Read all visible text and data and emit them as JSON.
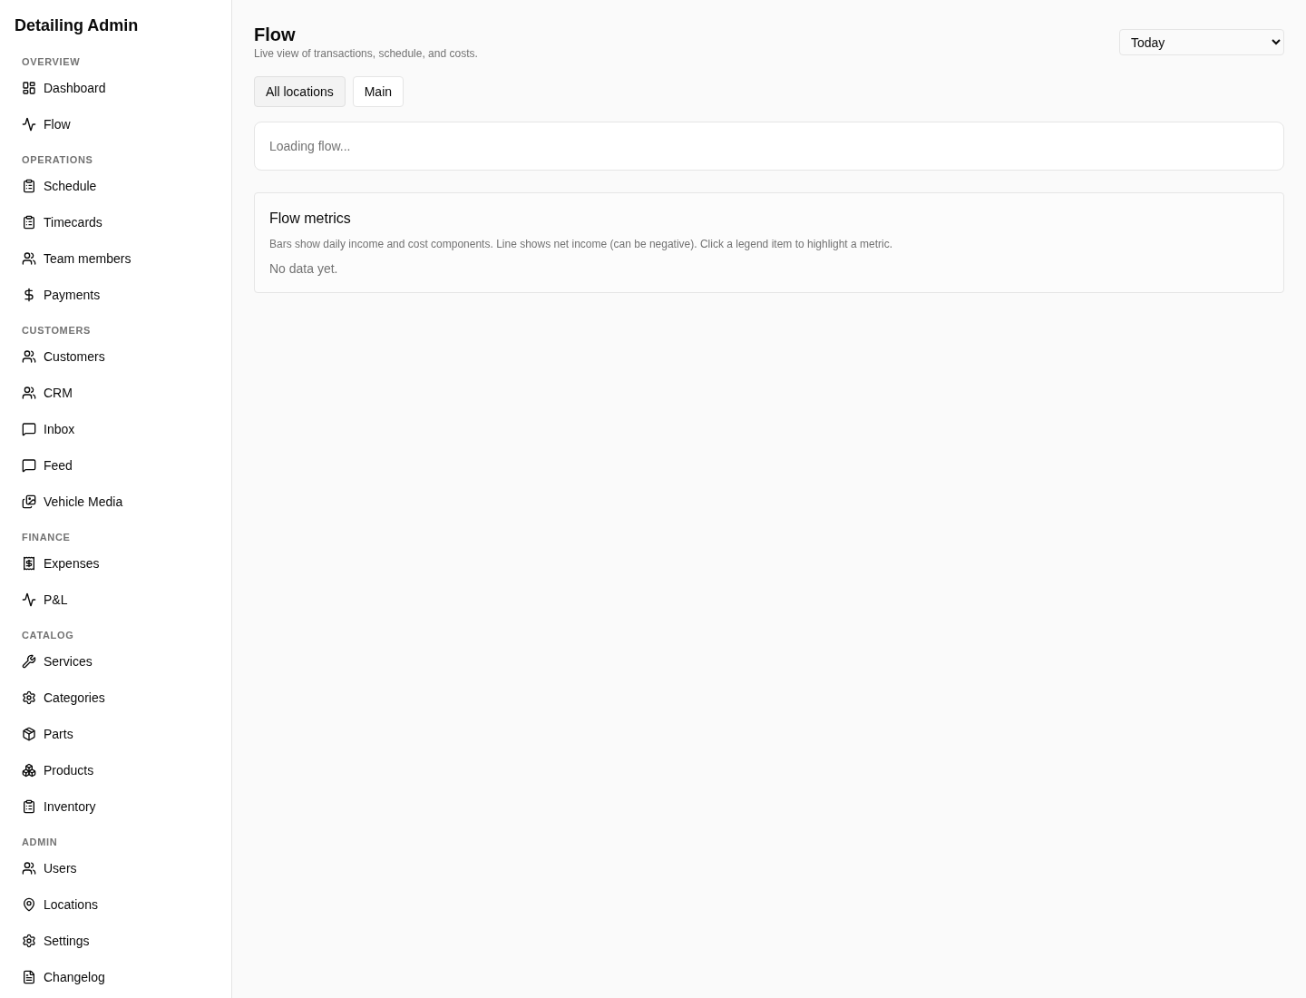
{
  "sidebar": {
    "title": "Detailing Admin",
    "sections": [
      {
        "label": "OVERVIEW",
        "items": [
          {
            "label": "Dashboard"
          },
          {
            "label": "Flow"
          }
        ]
      },
      {
        "label": "OPERATIONS",
        "items": [
          {
            "label": "Schedule"
          },
          {
            "label": "Timecards"
          },
          {
            "label": "Team members"
          },
          {
            "label": "Payments"
          }
        ]
      },
      {
        "label": "CUSTOMERS",
        "items": [
          {
            "label": "Customers"
          },
          {
            "label": "CRM"
          },
          {
            "label": "Inbox"
          },
          {
            "label": "Feed"
          },
          {
            "label": "Vehicle Media"
          }
        ]
      },
      {
        "label": "FINANCE",
        "items": [
          {
            "label": "Expenses"
          },
          {
            "label": "P&L"
          }
        ]
      },
      {
        "label": "CATALOG",
        "items": [
          {
            "label": "Services"
          },
          {
            "label": "Categories"
          },
          {
            "label": "Parts"
          },
          {
            "label": "Products"
          },
          {
            "label": "Inventory"
          }
        ]
      },
      {
        "label": "ADMIN",
        "items": [
          {
            "label": "Users"
          },
          {
            "label": "Locations"
          },
          {
            "label": "Settings"
          },
          {
            "label": "Changelog"
          }
        ]
      }
    ]
  },
  "header": {
    "title": "Flow",
    "subtitle": "Live view of transactions, schedule, and costs.",
    "range_select": {
      "value": "Today"
    }
  },
  "location_tabs": [
    {
      "label": "All locations",
      "selected": true
    },
    {
      "label": "Main",
      "selected": false
    }
  ],
  "status_card": {
    "text": "Loading flow..."
  },
  "metrics_card": {
    "title": "Flow metrics",
    "description": "Bars show daily income and cost components. Line shows net income (can be negative). Click a legend item to highlight a metric.",
    "empty_text": "No data yet."
  }
}
